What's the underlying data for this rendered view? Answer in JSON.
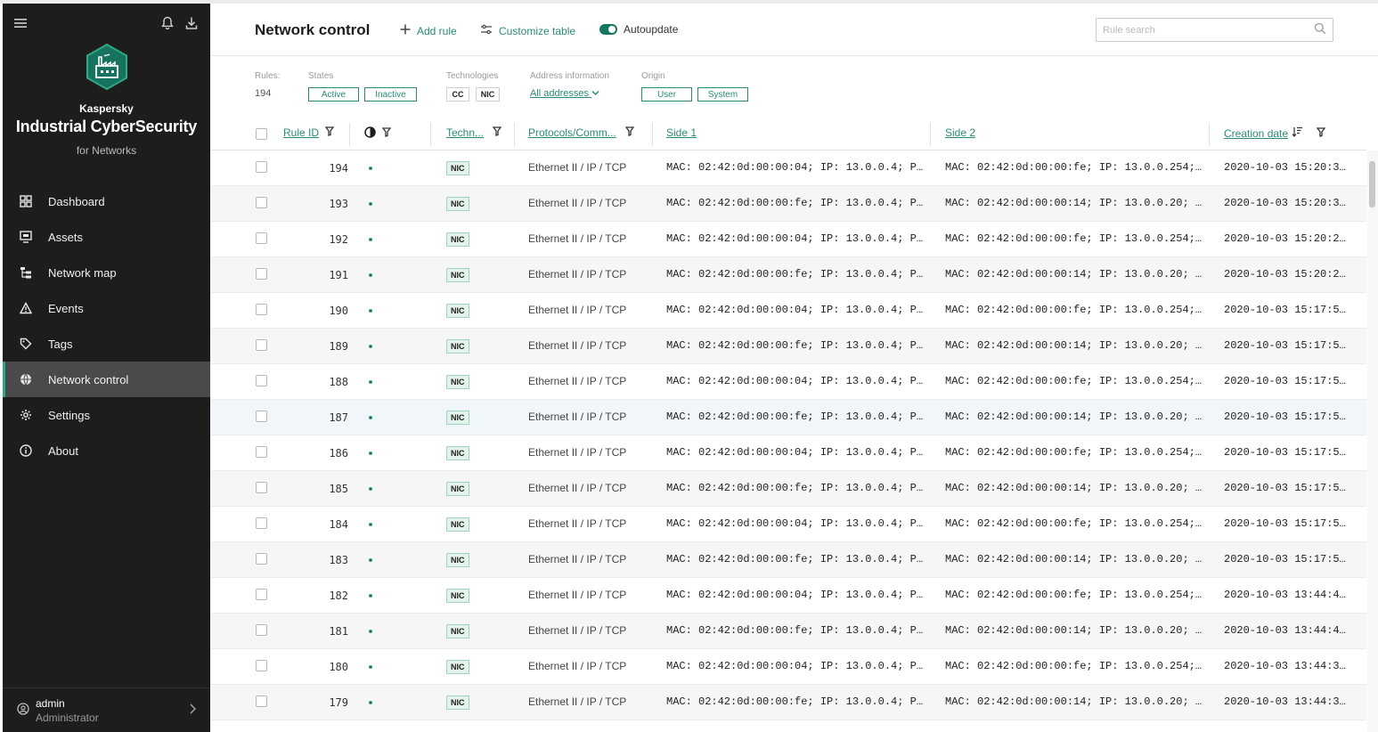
{
  "sidebar": {
    "brand_small": "Kaspersky",
    "brand_main": "Industrial CyberSecurity",
    "brand_sub": "for Networks",
    "items": [
      {
        "label": "Dashboard",
        "icon": "dashboard-icon"
      },
      {
        "label": "Assets",
        "icon": "assets-icon"
      },
      {
        "label": "Network map",
        "icon": "network-map-icon"
      },
      {
        "label": "Events",
        "icon": "warning-icon"
      },
      {
        "label": "Tags",
        "icon": "tag-icon"
      },
      {
        "label": "Network control",
        "icon": "globe-icon",
        "active": true
      },
      {
        "label": "Settings",
        "icon": "gear-icon"
      },
      {
        "label": "About",
        "icon": "info-icon"
      }
    ],
    "user": {
      "name": "admin",
      "role": "Administrator"
    }
  },
  "header": {
    "title": "Network control",
    "add_rule": "Add rule",
    "customize": "Customize table",
    "autoupdate": "Autoupdate",
    "search_placeholder": "Rule search"
  },
  "filters": {
    "rules_label": "Rules:",
    "rules_count": "194",
    "states_label": "States",
    "states": [
      "Active",
      "Inactive"
    ],
    "tech_label": "Technologies",
    "techs": [
      "CC",
      "NIC"
    ],
    "address_label": "Address information",
    "address_value": "All addresses",
    "origin_label": "Origin",
    "origins": [
      "User",
      "System"
    ]
  },
  "columns": {
    "rule_id": "Rule ID",
    "tech": "Techn...",
    "protocols": "Protocols/Comm...",
    "side1": "Side 1",
    "side2": "Side 2",
    "creation": "Creation date"
  },
  "rows": [
    {
      "id": "194",
      "tech": "NIC",
      "proto": "Ethernet II / IP / TCP",
      "side1": "MAC: 02:42:0d:00:00:04; IP: 13.0.0.4; Po…",
      "side2": "MAC: 02:42:0d:00:00:fe; IP: 13.0.0.254; …",
      "date": "2020-10-03 15:20:3…"
    },
    {
      "id": "193",
      "tech": "NIC",
      "proto": "Ethernet II / IP / TCP",
      "side1": "MAC: 02:42:0d:00:00:fe; IP: 13.0.0.4; Po…",
      "side2": "MAC: 02:42:0d:00:00:14; IP: 13.0.0.20; P…",
      "date": "2020-10-03 15:20:3…"
    },
    {
      "id": "192",
      "tech": "NIC",
      "proto": "Ethernet II / IP / TCP",
      "side1": "MAC: 02:42:0d:00:00:04; IP: 13.0.0.4; Po…",
      "side2": "MAC: 02:42:0d:00:00:fe; IP: 13.0.0.254; …",
      "date": "2020-10-03 15:20:2…"
    },
    {
      "id": "191",
      "tech": "NIC",
      "proto": "Ethernet II / IP / TCP",
      "side1": "MAC: 02:42:0d:00:00:fe; IP: 13.0.0.4; Po…",
      "side2": "MAC: 02:42:0d:00:00:14; IP: 13.0.0.20; P…",
      "date": "2020-10-03 15:20:2…"
    },
    {
      "id": "190",
      "tech": "NIC",
      "proto": "Ethernet II / IP / TCP",
      "side1": "MAC: 02:42:0d:00:00:04; IP: 13.0.0.4; Po…",
      "side2": "MAC: 02:42:0d:00:00:fe; IP: 13.0.0.254; …",
      "date": "2020-10-03 15:17:5…"
    },
    {
      "id": "189",
      "tech": "NIC",
      "proto": "Ethernet II / IP / TCP",
      "side1": "MAC: 02:42:0d:00:00:fe; IP: 13.0.0.4; Po…",
      "side2": "MAC: 02:42:0d:00:00:14; IP: 13.0.0.20; P…",
      "date": "2020-10-03 15:17:5…"
    },
    {
      "id": "188",
      "tech": "NIC",
      "proto": "Ethernet II / IP / TCP",
      "side1": "MAC: 02:42:0d:00:00:04; IP: 13.0.0.4; Po…",
      "side2": "MAC: 02:42:0d:00:00:fe; IP: 13.0.0.254; …",
      "date": "2020-10-03 15:17:5…"
    },
    {
      "id": "187",
      "tech": "NIC",
      "proto": "Ethernet II / IP / TCP",
      "side1": "MAC: 02:42:0d:00:00:fe; IP: 13.0.0.4; Po…",
      "side2": "MAC: 02:42:0d:00:00:14; IP: 13.0.0.20; P…",
      "date": "2020-10-03 15:17:5…"
    },
    {
      "id": "186",
      "tech": "NIC",
      "proto": "Ethernet II / IP / TCP",
      "side1": "MAC: 02:42:0d:00:00:04; IP: 13.0.0.4; Po…",
      "side2": "MAC: 02:42:0d:00:00:fe; IP: 13.0.0.254; …",
      "date": "2020-10-03 15:17:5…"
    },
    {
      "id": "185",
      "tech": "NIC",
      "proto": "Ethernet II / IP / TCP",
      "side1": "MAC: 02:42:0d:00:00:fe; IP: 13.0.0.4; Po…",
      "side2": "MAC: 02:42:0d:00:00:14; IP: 13.0.0.20; P…",
      "date": "2020-10-03 15:17:5…"
    },
    {
      "id": "184",
      "tech": "NIC",
      "proto": "Ethernet II / IP / TCP",
      "side1": "MAC: 02:42:0d:00:00:04; IP: 13.0.0.4; Po…",
      "side2": "MAC: 02:42:0d:00:00:fe; IP: 13.0.0.254; …",
      "date": "2020-10-03 15:17:5…"
    },
    {
      "id": "183",
      "tech": "NIC",
      "proto": "Ethernet II / IP / TCP",
      "side1": "MAC: 02:42:0d:00:00:fe; IP: 13.0.0.4; Po…",
      "side2": "MAC: 02:42:0d:00:00:14; IP: 13.0.0.20; P…",
      "date": "2020-10-03 15:17:5…"
    },
    {
      "id": "182",
      "tech": "NIC",
      "proto": "Ethernet II / IP / TCP",
      "side1": "MAC: 02:42:0d:00:00:04; IP: 13.0.0.4; Po…",
      "side2": "MAC: 02:42:0d:00:00:fe; IP: 13.0.0.254; …",
      "date": "2020-10-03 13:44:4…"
    },
    {
      "id": "181",
      "tech": "NIC",
      "proto": "Ethernet II / IP / TCP",
      "side1": "MAC: 02:42:0d:00:00:fe; IP: 13.0.0.4; Po…",
      "side2": "MAC: 02:42:0d:00:00:14; IP: 13.0.0.20; P…",
      "date": "2020-10-03 13:44:4…"
    },
    {
      "id": "180",
      "tech": "NIC",
      "proto": "Ethernet II / IP / TCP",
      "side1": "MAC: 02:42:0d:00:00:04; IP: 13.0.0.4; Po…",
      "side2": "MAC: 02:42:0d:00:00:fe; IP: 13.0.0.254; …",
      "date": "2020-10-03 13:44:3…"
    },
    {
      "id": "179",
      "tech": "NIC",
      "proto": "Ethernet II / IP / TCP",
      "side1": "MAC: 02:42:0d:00:00:fe; IP: 13.0.0.4; Po…",
      "side2": "MAC: 02:42:0d:00:00:14; IP: 13.0.0.20; P…",
      "date": "2020-10-03 13:44:3…"
    }
  ],
  "colors": {
    "accent": "#2a8a76",
    "sidebar": "#1d1d1b",
    "active_item": "#4a4a4a"
  }
}
